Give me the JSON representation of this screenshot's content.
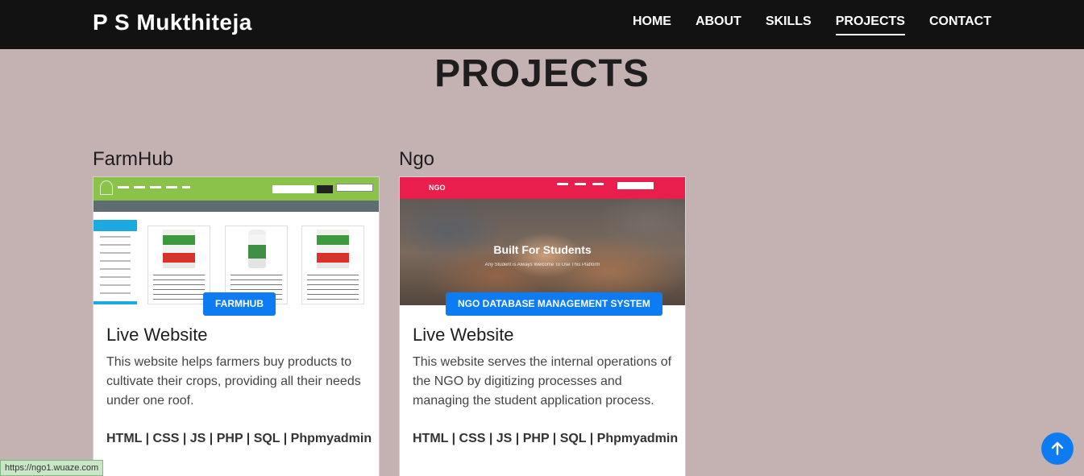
{
  "navbar": {
    "brand": "P S Mukthiteja",
    "links": [
      "HOME",
      "ABOUT",
      "SKILLS",
      "PROJECTS",
      "CONTACT"
    ],
    "active_link": "PROJECTS"
  },
  "page_title": "PROJECTS",
  "projects": [
    {
      "name": "FarmHub",
      "button_label": "FARMHUB",
      "card_title": "Live Website",
      "description": "This website helps farmers buy products to cultivate their crops, providing all their needs under one roof.",
      "tech": "HTML | CSS | JS | PHP | SQL | Phpmyadmin"
    },
    {
      "name": "Ngo",
      "button_label": "NGO DATABASE MANAGEMENT SYSTEM",
      "card_title": "Live Website",
      "description": "This website serves the internal operations of the NGO by digitizing processes and managing the student application process.",
      "tech": "HTML | CSS | JS | PHP | SQL | Phpmyadmin",
      "thumbnail": {
        "logo": "NGO",
        "hero_title": "Built For Students",
        "hero_subtitle": "Any Student is Always Welcome To Use This Platform"
      }
    }
  ],
  "status_bar_url": "https://ngo1.wuaze.com",
  "scroll_top_icon": "arrow-up-icon",
  "colors": {
    "navbar_bg": "#121212",
    "page_bg": "#c4b1b2",
    "button_blue": "#0d7cf2",
    "farmhub_green": "#8bc34a",
    "ngo_pink": "#e91e4d"
  }
}
